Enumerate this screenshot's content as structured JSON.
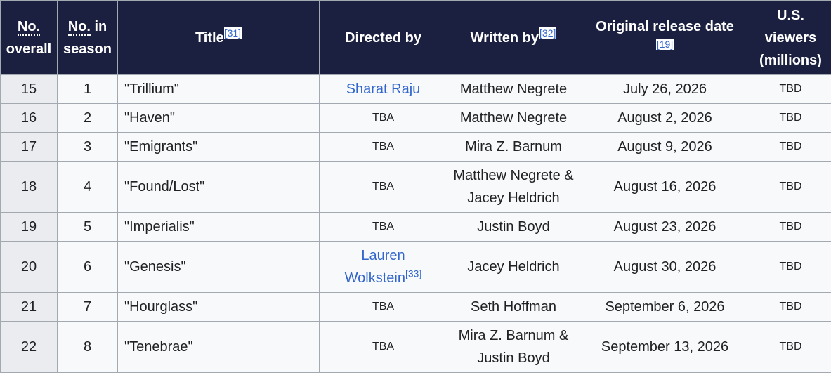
{
  "headers": {
    "no_overall_abbr": "No.",
    "no_overall_rest": "overall",
    "no_season_abbr": "No.",
    "no_season_rest": "in season",
    "title": "Title",
    "title_ref": "[31]",
    "directed_by": "Directed by",
    "written_by": "Written by",
    "written_by_ref": "[32]",
    "release_date": "Original release date",
    "release_date_ref": "[19]",
    "viewers": "U.S. viewers (millions)"
  },
  "rows": [
    {
      "overall": "15",
      "season": "1",
      "title": "\"Trillium\"",
      "director": "Sharat Raju",
      "director_ref": "",
      "writer": "Matthew Negrete",
      "writer2": "",
      "date": "July 26, 2026",
      "viewers": "TBD"
    },
    {
      "overall": "16",
      "season": "2",
      "title": "\"Haven\"",
      "director": "TBA",
      "director_ref": "",
      "writer": "Matthew Negrete",
      "writer2": "",
      "date": "August 2, 2026",
      "viewers": "TBD"
    },
    {
      "overall": "17",
      "season": "3",
      "title": "\"Emigrants\"",
      "director": "TBA",
      "director_ref": "",
      "writer": "Mira Z. Barnum",
      "writer2": "",
      "date": "August 9, 2026",
      "viewers": "TBD"
    },
    {
      "overall": "18",
      "season": "4",
      "title": "\"Found/Lost\"",
      "director": "TBA",
      "director_ref": "",
      "writer": "Matthew Negrete &",
      "writer2": "Jacey Heldrich",
      "date": "August 16, 2026",
      "viewers": "TBD"
    },
    {
      "overall": "19",
      "season": "5",
      "title": "\"Imperialis\"",
      "director": "TBA",
      "director_ref": "",
      "writer": "Justin Boyd",
      "writer2": "",
      "date": "August 23, 2026",
      "viewers": "TBD"
    },
    {
      "overall": "20",
      "season": "6",
      "title": "\"Genesis\"",
      "director": "Lauren",
      "director2": "Wolkstein",
      "director_ref": "[33]",
      "writer": "Jacey Heldrich",
      "writer2": "",
      "date": "August 30, 2026",
      "viewers": "TBD"
    },
    {
      "overall": "21",
      "season": "7",
      "title": "\"Hourglass\"",
      "director": "TBA",
      "director_ref": "",
      "writer": "Seth Hoffman",
      "writer2": "",
      "date": "September 6, 2026",
      "viewers": "TBD"
    },
    {
      "overall": "22",
      "season": "8",
      "title": "\"Tenebrae\"",
      "director": "TBA",
      "director_ref": "",
      "writer": "Mira Z. Barnum &",
      "writer2": "Justin Boyd",
      "date": "September 13, 2026",
      "viewers": "TBD"
    }
  ]
}
